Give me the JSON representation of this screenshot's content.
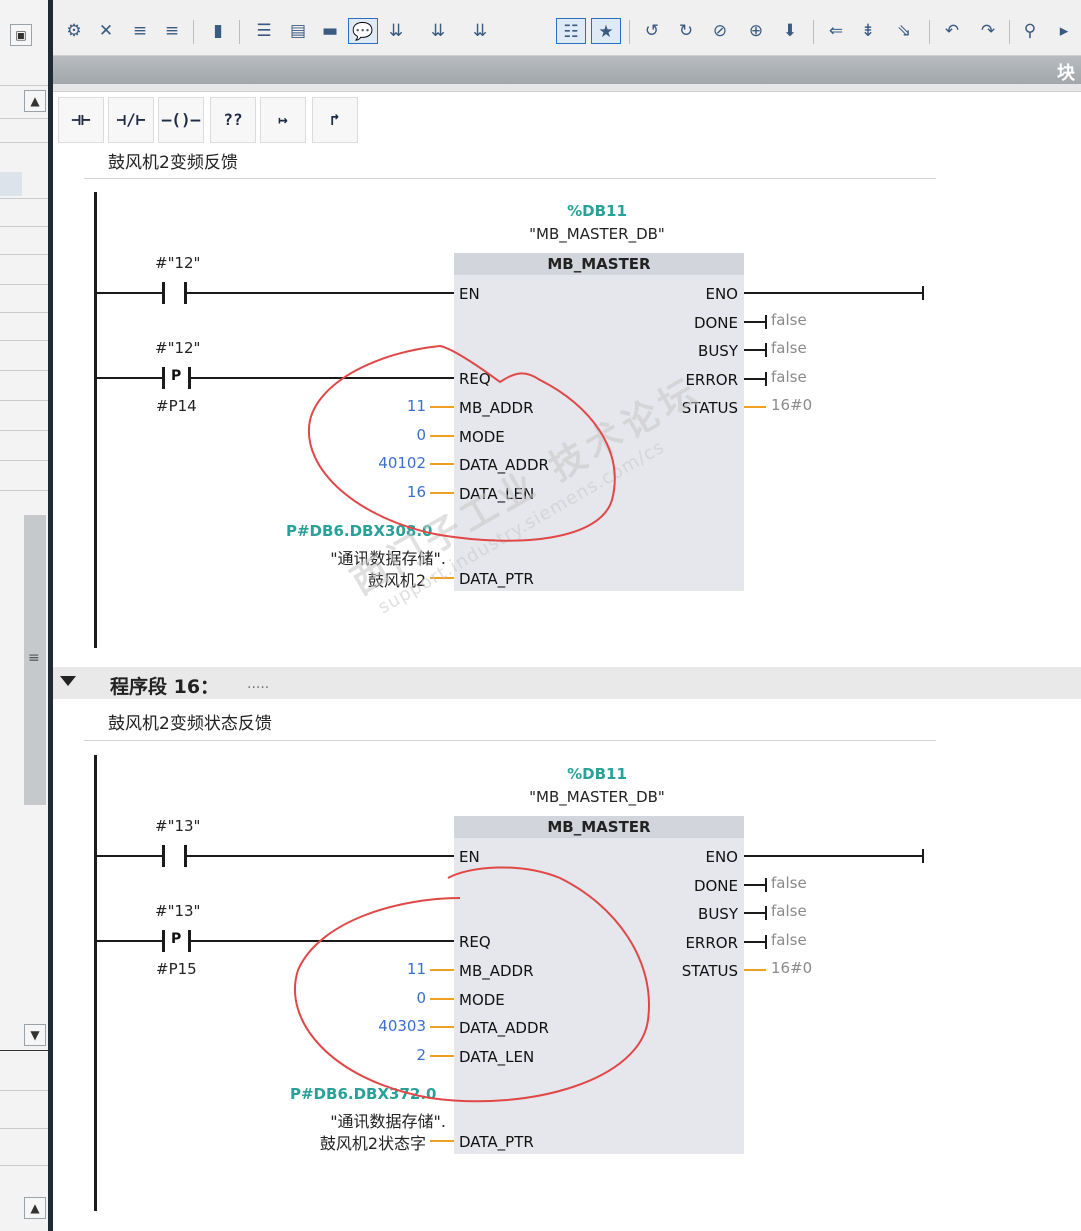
{
  "toolbar": {
    "title_label": "块",
    "icons": [
      "monitor-icon",
      "variable-icon",
      "settings-icon",
      "branch-icon",
      "branch-close-icon",
      "network-insert-icon",
      "network-delete-icon",
      "comment-icon",
      "align-icon",
      "block-icon",
      "block-add-icon",
      "block-remove-icon",
      "list-icon",
      "favorites-icon",
      "prev-icon",
      "next-icon",
      "error-icon",
      "warning-icon",
      "compile-icon",
      "goto-icon",
      "step-icon",
      "run-icon",
      "break-icon",
      "return-icon",
      "tools-icon"
    ]
  },
  "palette": {
    "no_contact": "⊣⊢",
    "nc_contact": "⊣/⊢",
    "coil": "–()–",
    "empty_box": "??",
    "open_branch": "↦",
    "close_branch": "↱"
  },
  "network15": {
    "comment": "鼓风机2变频反馈",
    "db_number": "%DB11",
    "db_name": "\"MB_MASTER_DB\"",
    "block_name": "MB_MASTER",
    "contact1_tag": "#\"12\"",
    "contact2_tag": "#\"12\"",
    "contact2_pmark": "P",
    "edge_mem": "#P14",
    "inputs": {
      "en": "EN",
      "req": "REQ",
      "mb_addr": "MB_ADDR",
      "mode": "MODE",
      "data_addr": "DATA_ADDR",
      "data_len": "DATA_LEN",
      "data_ptr": "DATA_PTR"
    },
    "input_values": {
      "mb_addr": "11",
      "mode": "0",
      "data_addr": "40102",
      "data_len": "16"
    },
    "outputs": {
      "eno": "ENO",
      "done": "DONE",
      "busy": "BUSY",
      "error": "ERROR",
      "status": "STATUS"
    },
    "output_values": {
      "done": "false",
      "busy": "false",
      "error": "false",
      "status": "16#0"
    },
    "ptr_address": "P#DB6.DBX308.0",
    "ptr_line1": "\"通讯数据存储\".",
    "ptr_line2": "鼓风机2"
  },
  "segment": {
    "title": "程序段 16：",
    "dots": "....."
  },
  "network16": {
    "comment": "鼓风机2变频状态反馈",
    "db_number": "%DB11",
    "db_name": "\"MB_MASTER_DB\"",
    "block_name": "MB_MASTER",
    "contact1_tag": "#\"13\"",
    "contact2_tag": "#\"13\"",
    "contact2_pmark": "P",
    "edge_mem": "#P15",
    "inputs": {
      "en": "EN",
      "req": "REQ",
      "mb_addr": "MB_ADDR",
      "mode": "MODE",
      "data_addr": "DATA_ADDR",
      "data_len": "DATA_LEN",
      "data_ptr": "DATA_PTR"
    },
    "input_values": {
      "mb_addr": "11",
      "mode": "0",
      "data_addr": "40303",
      "data_len": "2"
    },
    "outputs": {
      "eno": "ENO",
      "done": "DONE",
      "busy": "BUSY",
      "error": "ERROR",
      "status": "STATUS"
    },
    "output_values": {
      "done": "false",
      "busy": "false",
      "error": "false",
      "status": "16#0"
    },
    "ptr_address": "P#DB6.DBX372.0",
    "ptr_line1": "\"通讯数据存储\".",
    "ptr_line2": "鼓风机2状态字"
  },
  "watermark": {
    "line1": "西门子工业 技术论坛",
    "line2": "support.industry.siemens.com/cs"
  },
  "colors": {
    "annotation": "#e04848",
    "param_value": "#3a6fd0",
    "db_teal": "#2aa198",
    "wire_orange": "#f0a020",
    "block_fill": "#e5e7ec"
  }
}
